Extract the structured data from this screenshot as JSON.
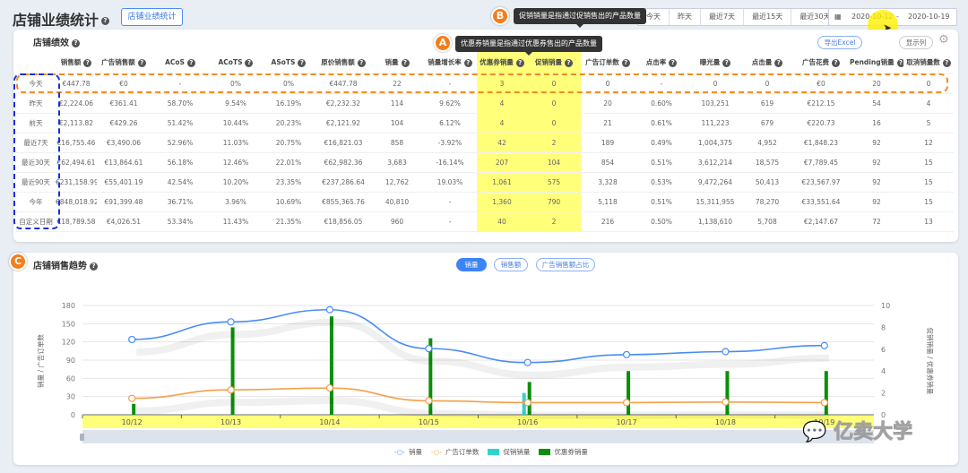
{
  "header": {
    "title": "店铺业绩统计",
    "button": "店铺业绩统计"
  },
  "annotations": {
    "A": "A",
    "B": "B",
    "C": "C"
  },
  "tooltips": {
    "promo": "促销销量是指通过促销售出的产品数量",
    "coupon": "优惠券销量是指通过优惠券售出的产品数量"
  },
  "quick_ranges": [
    "今天",
    "昨天",
    "最近7天",
    "最近15天",
    "最近30天"
  ],
  "date_range": {
    "start": "2020-10-12",
    "sep": "-",
    "end": "2020-10-19"
  },
  "perf": {
    "title": "店铺绩效",
    "export": "导出Excel",
    "columns_btn": "显示列",
    "headers": [
      "销售额",
      "广告销售额",
      "ACoS",
      "ACoTS",
      "ASoTS",
      "原价销售额",
      "销量",
      "销量增长率",
      "优惠券销量",
      "促销销量",
      "广告订单数",
      "点击率",
      "曝光量",
      "点击量",
      "广告花费",
      "Pending销量",
      "取消销量数"
    ],
    "rows": [
      {
        "label": "今天",
        "cells": [
          "€447.78",
          "€0",
          "-",
          "0%",
          "0%",
          "€447.78",
          "22",
          "-",
          "3",
          "0",
          "0",
          "-",
          "0",
          "0",
          "€0",
          "20",
          "0"
        ]
      },
      {
        "label": "昨天",
        "cells": [
          "€2,224.06",
          "€361.41",
          "58.70%",
          "9.54%",
          "16.19%",
          "€2,232.32",
          "114",
          "9.62%",
          "4",
          "0",
          "20",
          "0.60%",
          "103,251",
          "619",
          "€212.15",
          "54",
          "4"
        ]
      },
      {
        "label": "前天",
        "cells": [
          "€2,113.82",
          "€429.26",
          "51.42%",
          "10.44%",
          "20.23%",
          "€2,121.92",
          "104",
          "6.12%",
          "4",
          "0",
          "21",
          "0.61%",
          "111,223",
          "679",
          "€220.73",
          "16",
          "5"
        ]
      },
      {
        "label": "最近7天",
        "cells": [
          "€16,755.46",
          "€3,490.06",
          "52.96%",
          "11.03%",
          "20.75%",
          "€16,821.03",
          "858",
          "-3.92%",
          "42",
          "2",
          "189",
          "0.49%",
          "1,004,375",
          "4,952",
          "€1,848.23",
          "92",
          "12"
        ]
      },
      {
        "label": "最近30天",
        "cells": [
          "€62,494.61",
          "€13,864.61",
          "56.18%",
          "12.46%",
          "22.01%",
          "€62,982.36",
          "3,683",
          "-16.14%",
          "207",
          "104",
          "854",
          "0.51%",
          "3,612,214",
          "18,575",
          "€7,789.45",
          "92",
          "15"
        ]
      },
      {
        "label": "最近90天",
        "cells": [
          "€231,158.99",
          "€55,401.19",
          "42.54%",
          "10.20%",
          "23.35%",
          "€237,286.64",
          "12,762",
          "19.03%",
          "1,061",
          "575",
          "3,328",
          "0.53%",
          "9,472,264",
          "50,413",
          "€23,567.97",
          "92",
          "15"
        ]
      },
      {
        "label": "今年",
        "cells": [
          "€848,018.92",
          "€91,399.48",
          "36.71%",
          "3.96%",
          "10.69%",
          "€855,365.76",
          "40,810",
          "-",
          "1,360",
          "790",
          "5,118",
          "0.51%",
          "15,311,955",
          "78,270",
          "€33,551.64",
          "92",
          "15"
        ]
      },
      {
        "label": "自定义日期",
        "cells": [
          "€18,789.58",
          "€4,026.51",
          "53.34%",
          "11.43%",
          "21.35%",
          "€18,856.05",
          "960",
          "-",
          "40",
          "2",
          "216",
          "0.50%",
          "1,138,610",
          "5,708",
          "€2,147.67",
          "72",
          "13"
        ]
      }
    ]
  },
  "trend": {
    "title": "店铺销售趋势",
    "tabs": [
      "销量",
      "销售额",
      "广告销售额占比"
    ],
    "watermark": "亿卖大学"
  },
  "chart_data": {
    "type": "bar+line",
    "categories": [
      "10/12",
      "10/13",
      "10/14",
      "10/15",
      "10/16",
      "10/17",
      "10/18",
      "10/19"
    ],
    "ylabel_left": "销量 / 广告订单数",
    "ylabel_right": "促销销量 / 优惠券销量",
    "ylim_left": [
      0,
      180
    ],
    "yticks_left": [
      0,
      30,
      60,
      90,
      120,
      150,
      180
    ],
    "ylim_right": [
      0,
      10
    ],
    "yticks_right": [
      0,
      2,
      4,
      6,
      8,
      10
    ],
    "series": [
      {
        "name": "销量",
        "type": "line",
        "axis": "left",
        "color": "#4a8cf7",
        "values": [
          124,
          153,
          173,
          109,
          86,
          99,
          104,
          114
        ]
      },
      {
        "name": "广告订单数",
        "type": "line",
        "axis": "left",
        "color": "#f5a04a",
        "values": [
          27,
          41,
          44,
          23,
          20,
          20,
          21,
          20
        ]
      },
      {
        "name": "促销销量",
        "type": "bar",
        "axis": "right",
        "color": "#2dd4d0",
        "values": [
          0,
          0,
          0,
          0,
          2,
          0,
          0,
          0
        ]
      },
      {
        "name": "优惠券销量",
        "type": "bar",
        "axis": "right",
        "color": "#0a8f0a",
        "values": [
          1,
          8,
          9,
          7,
          3,
          4,
          4,
          4
        ]
      }
    ],
    "legend": "bottom-center"
  }
}
